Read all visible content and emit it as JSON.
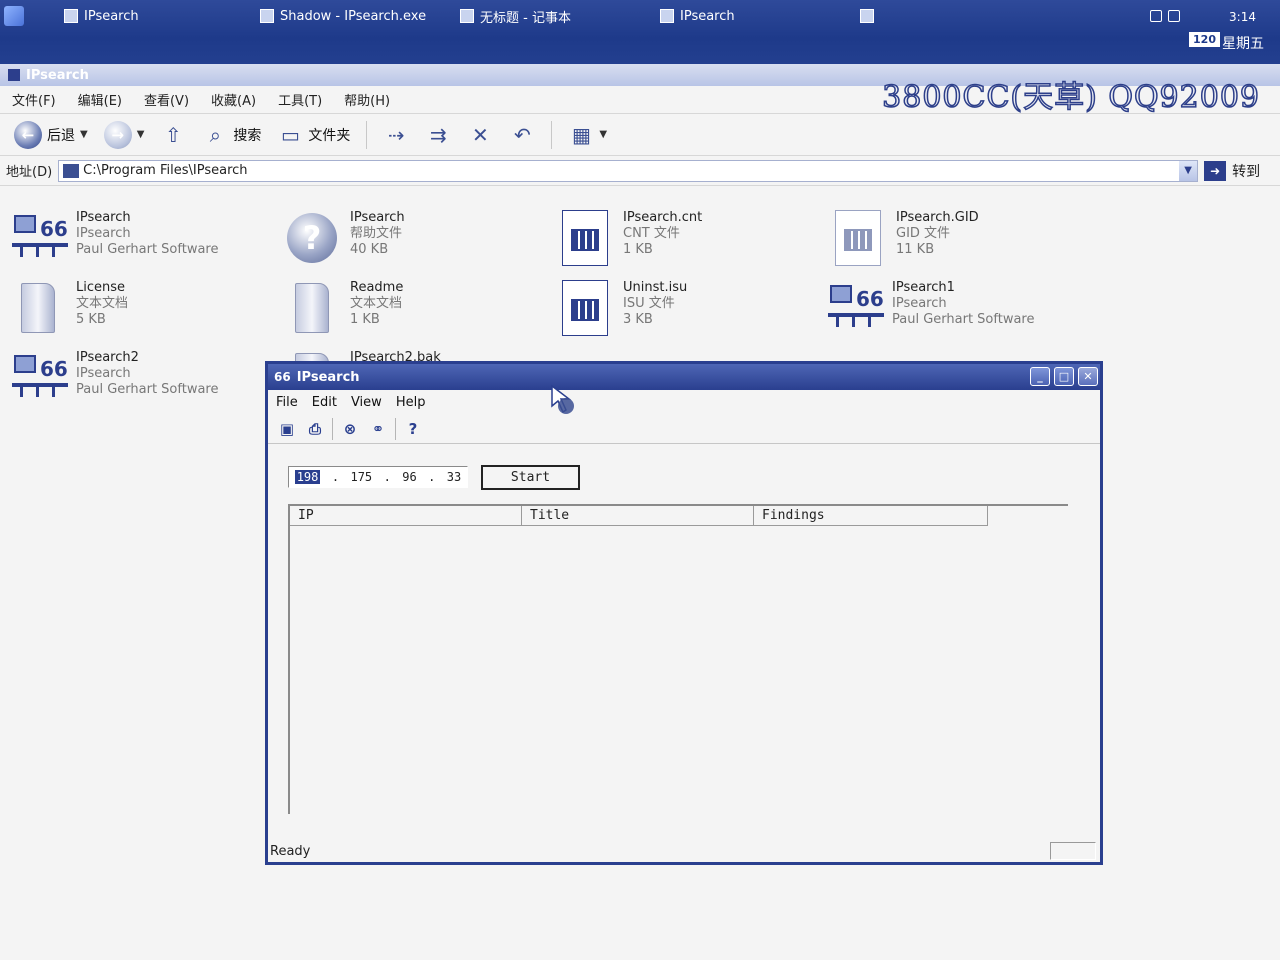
{
  "taskbar": {
    "tasks": [
      {
        "label": "IPsearch"
      },
      {
        "label": "Shadow - IPsearch.exe"
      },
      {
        "label": "无标题 - 记事本"
      },
      {
        "label": "IPsearch"
      }
    ],
    "tray": {
      "time": "3:14",
      "badge": "120",
      "day": "星期五"
    }
  },
  "explorer": {
    "title": "IPsearch",
    "watermark": "3800CC(天草) QQ92009",
    "menu": [
      "文件(F)",
      "编辑(E)",
      "查看(V)",
      "收藏(A)",
      "工具(T)",
      "帮助(H)"
    ],
    "toolbar": {
      "back": "后退",
      "search": "搜索",
      "folders": "文件夹"
    },
    "address": {
      "label": "地址(D)",
      "path": "C:\\Program Files\\IPsearch",
      "go": "转到"
    },
    "files": [
      {
        "name": "IPsearch",
        "line2": "IPsearch",
        "line3": "Paul Gerhart Software",
        "icon": "network-app-icon"
      },
      {
        "name": "IPsearch",
        "line2": "帮助文件",
        "line3": "40 KB",
        "icon": "help-icon"
      },
      {
        "name": "IPsearch.cnt",
        "line2": "CNT 文件",
        "line3": "1 KB",
        "icon": "sheet-icon"
      },
      {
        "name": "IPsearch.GID",
        "line2": "GID 文件",
        "line3": "11 KB",
        "icon": "sheet-icon"
      },
      {
        "name": "License",
        "line2": "文本文档",
        "line3": "5 KB",
        "icon": "text-doc-icon"
      },
      {
        "name": "Readme",
        "line2": "文本文档",
        "line3": "1 KB",
        "icon": "text-doc-icon"
      },
      {
        "name": "Uninst.isu",
        "line2": "ISU 文件",
        "line3": "3 KB",
        "icon": "sheet-icon"
      },
      {
        "name": "IPsearch1",
        "line2": "IPsearch",
        "line3": "Paul Gerhart Software",
        "icon": "network-app-icon"
      },
      {
        "name": "IPsearch2",
        "line2": "IPsearch",
        "line3": "Paul Gerhart Software",
        "icon": "network-app-icon"
      },
      {
        "name": "IPsearch2.bak",
        "line2": "",
        "line3": "",
        "icon": "text-doc-icon"
      }
    ]
  },
  "ipsearch": {
    "title": "IPsearch",
    "menu": [
      "File",
      "Edit",
      "View",
      "Help"
    ],
    "ip": [
      "198",
      "175",
      "96",
      "33"
    ],
    "start_label": "Start",
    "columns": [
      "IP",
      "Title",
      "Findings"
    ],
    "status": "Ready"
  },
  "colors": {
    "accent": "#2a3f8f",
    "taskbar": "#1e3a8a"
  }
}
